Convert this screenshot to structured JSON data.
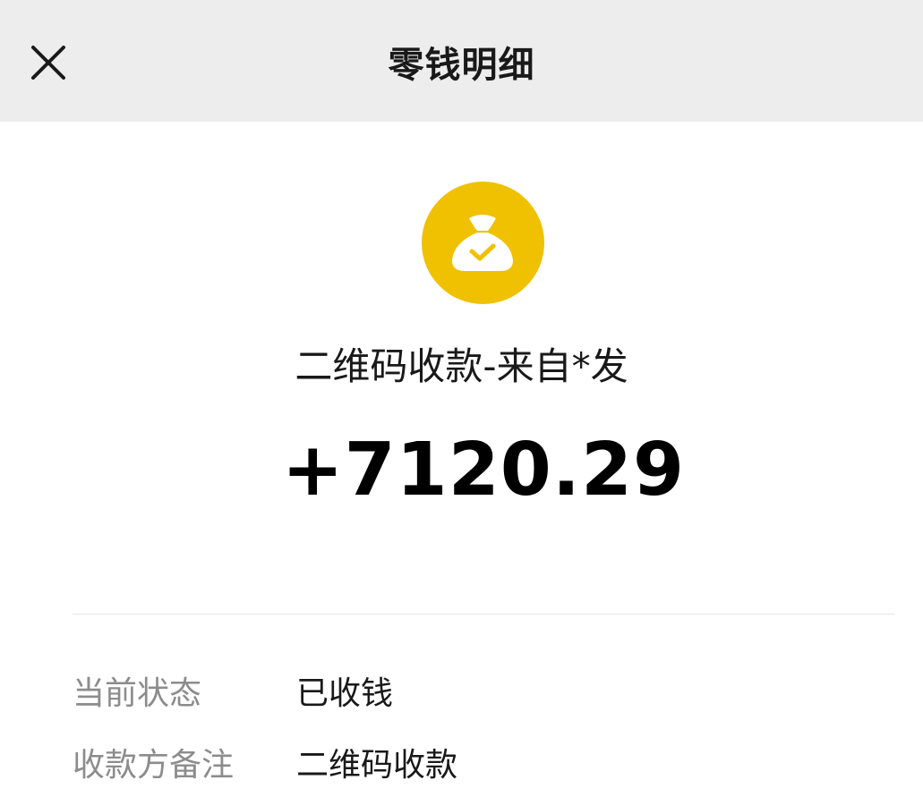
{
  "header": {
    "title": "零钱明细",
    "close_icon": "close-icon"
  },
  "transaction": {
    "icon": "money-bag-check-icon",
    "icon_color": "#efc100",
    "title": "二维码收款-来自*发",
    "amount": "+7120.29"
  },
  "details": [
    {
      "label": "当前状态",
      "value": "已收钱"
    },
    {
      "label": "收款方备注",
      "value": "二维码收款"
    }
  ]
}
